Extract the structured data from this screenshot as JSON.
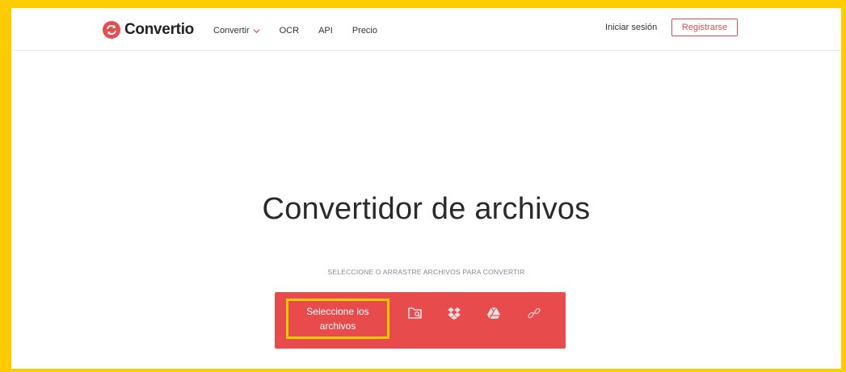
{
  "header": {
    "logo_text": "Convertio",
    "nav": {
      "convertir": "Convertir",
      "ocr": "OCR",
      "api": "API",
      "precio": "Precio"
    },
    "login": "Iniciar sesión",
    "register": "Registrarse"
  },
  "hero": {
    "title": "Convertidor de archivos",
    "subtitle": "SELECCIONE O ARRASTRE ARCHIVOS PARA CONVERTIR"
  },
  "select": {
    "button_line1": "Seleccione los",
    "button_line2": "archivos",
    "icons": [
      "folder-search-icon",
      "dropbox-icon",
      "google-drive-icon",
      "link-icon"
    ]
  },
  "colors": {
    "brand_red": "#e84b4b",
    "highlight_yellow": "#ffcc00"
  }
}
